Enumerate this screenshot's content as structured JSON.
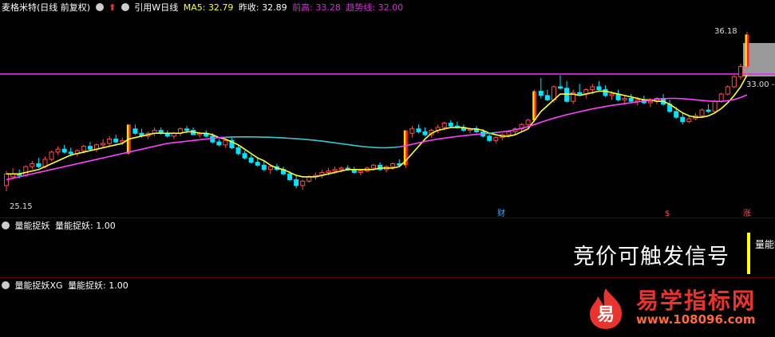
{
  "header": {
    "title": "麦格米特(日线 前复权)",
    "ref_label": "引用W日线",
    "ma5_label": "MA5:",
    "ma5_value": "32.79",
    "prev_close_label": "昨收:",
    "prev_close_value": "32.89",
    "prev_high_label": "前高:",
    "prev_high_value": "33.28",
    "trend_label": "趋势线:",
    "trend_value": "32.00"
  },
  "main_chart": {
    "price_high_label": "36.18",
    "price_low_label": "25.15",
    "right_price_label": "33.00 -",
    "event_markers": [
      "财",
      "$",
      "涨"
    ]
  },
  "panel2": {
    "title": "量能捉妖",
    "param": "量能捉妖: 1.00",
    "partial_label": "量能捉"
  },
  "panel3": {
    "title": "量能捉妖XG",
    "param": "量能捉妖: 1.00"
  },
  "notice": "竞价可触发信号",
  "watermark": {
    "logo_char": "易",
    "name": "易学指标网",
    "url": "www.108096.com"
  },
  "colors": {
    "up": "#ff4d4d",
    "down": "#00e5ff",
    "ma_short": "#ffff33",
    "ma_long_a": "#ff44ff",
    "ma_long_b": "#3cc8c8",
    "trend_line": "#dd33dd",
    "flag_yellow": "#ffdd00",
    "flag_red": "#ff2222"
  },
  "chart_data": {
    "type": "candlestick",
    "ylim": [
      24,
      37.5
    ],
    "horizontal_line": 33.28,
    "candles": [
      [
        25.6,
        26.6,
        25.2,
        26.4
      ],
      [
        26.2,
        26.8,
        26.0,
        26.4
      ],
      [
        26.4,
        26.7,
        26.1,
        26.3
      ],
      [
        26.3,
        27.0,
        26.2,
        26.9
      ],
      [
        26.9,
        27.3,
        26.7,
        27.1
      ],
      [
        27.1,
        27.5,
        26.8,
        26.9
      ],
      [
        26.9,
        27.6,
        26.8,
        27.4
      ],
      [
        27.4,
        28.0,
        27.3,
        27.9
      ],
      [
        27.9,
        28.3,
        27.7,
        28.1
      ],
      [
        28.1,
        28.4,
        27.8,
        27.9
      ],
      [
        27.9,
        28.2,
        27.6,
        27.8
      ],
      [
        27.8,
        28.1,
        27.6,
        28.0
      ],
      [
        28.0,
        28.4,
        27.8,
        28.3
      ],
      [
        28.3,
        28.6,
        28.0,
        28.1
      ],
      [
        28.1,
        28.5,
        27.9,
        28.4
      ],
      [
        28.4,
        28.8,
        28.2,
        28.5
      ],
      [
        28.5,
        29.0,
        28.3,
        28.8
      ],
      [
        28.8,
        29.1,
        28.5,
        28.6
      ],
      [
        28.6,
        28.9,
        28.4,
        28.7
      ],
      [
        27.8,
        29.8,
        27.7,
        29.8
      ],
      [
        29.5,
        29.8,
        29.1,
        29.2
      ],
      [
        29.2,
        29.5,
        28.9,
        29.0
      ],
      [
        29.0,
        29.3,
        28.8,
        29.2
      ],
      [
        29.2,
        29.6,
        29.0,
        29.4
      ],
      [
        29.4,
        29.6,
        29.1,
        29.2
      ],
      [
        29.2,
        29.4,
        28.9,
        29.0
      ],
      [
        29.0,
        29.3,
        28.8,
        29.2
      ],
      [
        29.2,
        29.6,
        29.0,
        29.5
      ],
      [
        29.5,
        29.7,
        29.2,
        29.4
      ],
      [
        29.4,
        29.6,
        29.1,
        29.1
      ],
      [
        29.1,
        29.3,
        28.9,
        29.2
      ],
      [
        29.2,
        29.4,
        28.9,
        29.0
      ],
      [
        29.0,
        29.2,
        28.5,
        28.6
      ],
      [
        28.6,
        28.8,
        28.3,
        28.4
      ],
      [
        28.4,
        28.8,
        28.2,
        28.7
      ],
      [
        28.7,
        28.9,
        28.1,
        28.2
      ],
      [
        28.2,
        28.4,
        27.7,
        27.8
      ],
      [
        27.8,
        28.0,
        27.4,
        27.5
      ],
      [
        27.5,
        27.7,
        27.1,
        27.2
      ],
      [
        27.2,
        27.5,
        26.9,
        27.0
      ],
      [
        27.0,
        27.3,
        26.6,
        26.7
      ],
      [
        26.7,
        27.0,
        26.4,
        26.9
      ],
      [
        26.9,
        27.1,
        26.6,
        26.7
      ],
      [
        26.7,
        26.9,
        26.3,
        26.4
      ],
      [
        26.4,
        26.6,
        25.9,
        26.0
      ],
      [
        26.0,
        26.3,
        25.4,
        25.6
      ],
      [
        25.6,
        26.0,
        25.3,
        25.9
      ],
      [
        25.9,
        26.3,
        25.8,
        26.2
      ],
      [
        26.2,
        26.5,
        26.0,
        26.3
      ],
      [
        26.3,
        26.7,
        26.1,
        26.5
      ],
      [
        26.5,
        26.8,
        26.3,
        26.6
      ],
      [
        26.6,
        26.9,
        26.4,
        26.7
      ],
      [
        26.7,
        26.9,
        26.5,
        26.8
      ],
      [
        26.8,
        27.0,
        26.6,
        26.7
      ],
      [
        26.7,
        26.9,
        26.4,
        26.5
      ],
      [
        26.5,
        26.7,
        26.3,
        26.6
      ],
      [
        26.6,
        26.9,
        26.5,
        26.8
      ],
      [
        26.8,
        27.1,
        26.7,
        27.0
      ],
      [
        27.0,
        27.2,
        26.6,
        26.7
      ],
      [
        26.7,
        27.0,
        26.5,
        26.9
      ],
      [
        26.9,
        27.2,
        26.7,
        27.1
      ],
      [
        27.1,
        27.4,
        26.9,
        27.0
      ],
      [
        27.0,
        29.4,
        26.8,
        29.4
      ],
      [
        29.2,
        29.7,
        28.9,
        29.5
      ],
      [
        29.5,
        29.8,
        29.2,
        29.3
      ],
      [
        29.3,
        29.6,
        29.0,
        29.1
      ],
      [
        29.1,
        29.5,
        28.9,
        29.4
      ],
      [
        29.4,
        29.8,
        29.2,
        29.6
      ],
      [
        29.6,
        30.0,
        29.4,
        29.9
      ],
      [
        29.9,
        30.1,
        29.6,
        29.7
      ],
      [
        29.7,
        30.0,
        29.5,
        29.6
      ],
      [
        29.6,
        29.8,
        29.3,
        29.4
      ],
      [
        29.4,
        29.6,
        29.2,
        29.5
      ],
      [
        29.5,
        29.7,
        29.2,
        29.3
      ],
      [
        29.3,
        29.5,
        28.9,
        29.0
      ],
      [
        29.0,
        29.2,
        28.6,
        28.7
      ],
      [
        28.7,
        29.0,
        28.5,
        28.9
      ],
      [
        28.9,
        29.2,
        28.7,
        29.1
      ],
      [
        29.1,
        29.4,
        28.9,
        29.3
      ],
      [
        29.3,
        29.6,
        29.1,
        29.5
      ],
      [
        29.5,
        29.9,
        29.3,
        29.8
      ],
      [
        29.8,
        30.2,
        29.6,
        30.1
      ],
      [
        30.1,
        32.2,
        30.0,
        32.1
      ],
      [
        32.1,
        33.0,
        31.6,
        31.8
      ],
      [
        31.8,
        32.2,
        31.4,
        31.5
      ],
      [
        31.5,
        32.5,
        31.3,
        32.4
      ],
      [
        32.4,
        33.2,
        32.2,
        32.3
      ],
      [
        32.3,
        32.8,
        31.3,
        31.4
      ],
      [
        31.4,
        32.2,
        31.2,
        32.0
      ],
      [
        32.0,
        32.6,
        31.8,
        31.9
      ],
      [
        31.9,
        32.3,
        31.6,
        32.2
      ],
      [
        32.2,
        32.6,
        31.9,
        32.4
      ],
      [
        32.4,
        32.8,
        32.1,
        32.2
      ],
      [
        32.2,
        32.5,
        31.7,
        31.8
      ],
      [
        31.8,
        32.1,
        31.5,
        31.9
      ],
      [
        31.9,
        32.2,
        31.4,
        31.5
      ],
      [
        31.5,
        31.8,
        31.2,
        31.6
      ],
      [
        31.6,
        31.9,
        31.3,
        31.4
      ],
      [
        31.4,
        31.7,
        31.1,
        31.5
      ],
      [
        31.5,
        31.8,
        31.2,
        31.3
      ],
      [
        31.3,
        31.6,
        31.0,
        31.4
      ],
      [
        31.4,
        31.7,
        31.2,
        31.6
      ],
      [
        31.6,
        31.9,
        31.1,
        31.2
      ],
      [
        31.2,
        31.5,
        30.6,
        30.7
      ],
      [
        30.7,
        31.0,
        30.2,
        30.3
      ],
      [
        30.3,
        30.6,
        29.8,
        30.0
      ],
      [
        30.0,
        30.4,
        29.9,
        30.2
      ],
      [
        30.2,
        30.6,
        30.1,
        30.4
      ],
      [
        30.4,
        30.9,
        30.3,
        30.8
      ],
      [
        30.8,
        31.2,
        30.6,
        30.7
      ],
      [
        30.7,
        31.5,
        30.6,
        31.4
      ],
      [
        31.4,
        32.0,
        31.3,
        31.9
      ],
      [
        31.9,
        32.5,
        31.8,
        32.4
      ],
      [
        32.4,
        33.2,
        32.3,
        33.1
      ],
      [
        33.1,
        34.0,
        32.9,
        33.8
      ],
      [
        33.8,
        36.2,
        33.6,
        36.0
      ]
    ],
    "ma_short": [
      26.4,
      26.4,
      26.4,
      26.5,
      26.6,
      26.7,
      26.9,
      27.1,
      27.3,
      27.5,
      27.7,
      27.8,
      27.9,
      28.0,
      28.1,
      28.2,
      28.3,
      28.4,
      28.5,
      28.8,
      28.9,
      29.0,
      29.1,
      29.2,
      29.2,
      29.2,
      29.2,
      29.2,
      29.3,
      29.3,
      29.2,
      29.2,
      29.1,
      28.9,
      28.8,
      28.6,
      28.4,
      28.1,
      27.8,
      27.5,
      27.3,
      27.0,
      26.8,
      26.7,
      26.5,
      26.3,
      26.2,
      26.2,
      26.2,
      26.3,
      26.4,
      26.5,
      26.6,
      26.7,
      26.7,
      26.7,
      26.7,
      26.7,
      26.8,
      26.8,
      26.8,
      26.9,
      27.3,
      27.8,
      28.3,
      28.8,
      29.2,
      29.4,
      29.5,
      29.6,
      29.6,
      29.6,
      29.5,
      29.5,
      29.4,
      29.2,
      29.1,
      29.0,
      29.0,
      29.1,
      29.3,
      29.5,
      30.1,
      30.7,
      31.1,
      31.5,
      31.9,
      31.9,
      31.9,
      31.8,
      31.9,
      32.0,
      32.1,
      32.1,
      32.0,
      31.9,
      31.8,
      31.7,
      31.6,
      31.5,
      31.5,
      31.4,
      31.4,
      31.2,
      30.9,
      30.6,
      30.4,
      30.3,
      30.3,
      30.4,
      30.6,
      30.9,
      31.3,
      31.8,
      32.4,
      33.2
    ],
    "ma_long": [
      26.0,
      26.1,
      26.2,
      26.3,
      26.4,
      26.5,
      26.6,
      26.7,
      26.8,
      26.9,
      27.0,
      27.1,
      27.2,
      27.3,
      27.4,
      27.5,
      27.6,
      27.7,
      27.8,
      27.9,
      28.0,
      28.1,
      28.2,
      28.3,
      28.4,
      28.5,
      28.55,
      28.6,
      28.65,
      28.7,
      28.75,
      28.8,
      28.85,
      28.9,
      28.92,
      28.94,
      28.95,
      28.95,
      28.95,
      28.94,
      28.93,
      28.92,
      28.9,
      28.88,
      28.85,
      28.82,
      28.79,
      28.75,
      28.71,
      28.66,
      28.6,
      28.54,
      28.48,
      28.42,
      28.36,
      28.3,
      28.26,
      28.22,
      28.2,
      28.2,
      28.22,
      28.26,
      28.34,
      28.44,
      28.54,
      28.64,
      28.72,
      28.8,
      28.86,
      28.92,
      28.98,
      29.03,
      29.08,
      29.12,
      29.16,
      29.2,
      29.25,
      29.3,
      29.36,
      29.44,
      29.54,
      29.66,
      29.8,
      29.96,
      30.1,
      30.24,
      30.36,
      30.48,
      30.58,
      30.68,
      30.78,
      30.88,
      30.96,
      31.04,
      31.12,
      31.18,
      31.24,
      31.3,
      31.36,
      31.42,
      31.48,
      31.54,
      31.58,
      31.6,
      31.6,
      31.58,
      31.54,
      31.5,
      31.46,
      31.42,
      31.4,
      31.4,
      31.44,
      31.52,
      31.66,
      31.84
    ]
  }
}
